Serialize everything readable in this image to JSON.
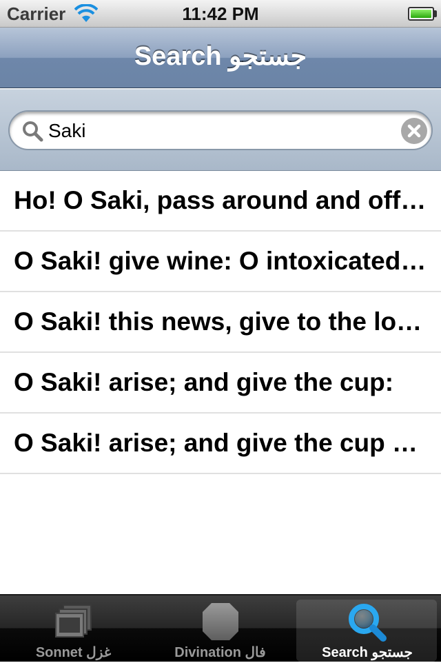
{
  "status_bar": {
    "carrier": "Carrier",
    "time": "11:42 PM",
    "battery_level": 1.0,
    "battery_color": "#3cc41a"
  },
  "nav_bar": {
    "title": "Search جستجو"
  },
  "search": {
    "value": "Saki",
    "search_icon": "magnifier-icon",
    "clear_icon": "clear-circle-icon"
  },
  "results": [
    {
      "text": "Ho! O Saki, pass around and offer the bowl"
    },
    {
      "text": "O Saki! give wine: O intoxicated one, tell"
    },
    {
      "text": "O Saki! this news, give to the lovers"
    },
    {
      "text": "O Saki! arise; and give the cup:"
    },
    {
      "text": "O Saki! arise; and give the cup of wine"
    }
  ],
  "tab_bar": {
    "tabs": [
      {
        "label": "Sonnet غزل",
        "icon": "book-stack-icon",
        "selected": false
      },
      {
        "label": "Divination فال",
        "icon": "hexagon-icon",
        "selected": false
      },
      {
        "label": "Search جستجو",
        "icon": "search-icon",
        "selected": true
      }
    ],
    "accent": "#2aa8f0"
  }
}
